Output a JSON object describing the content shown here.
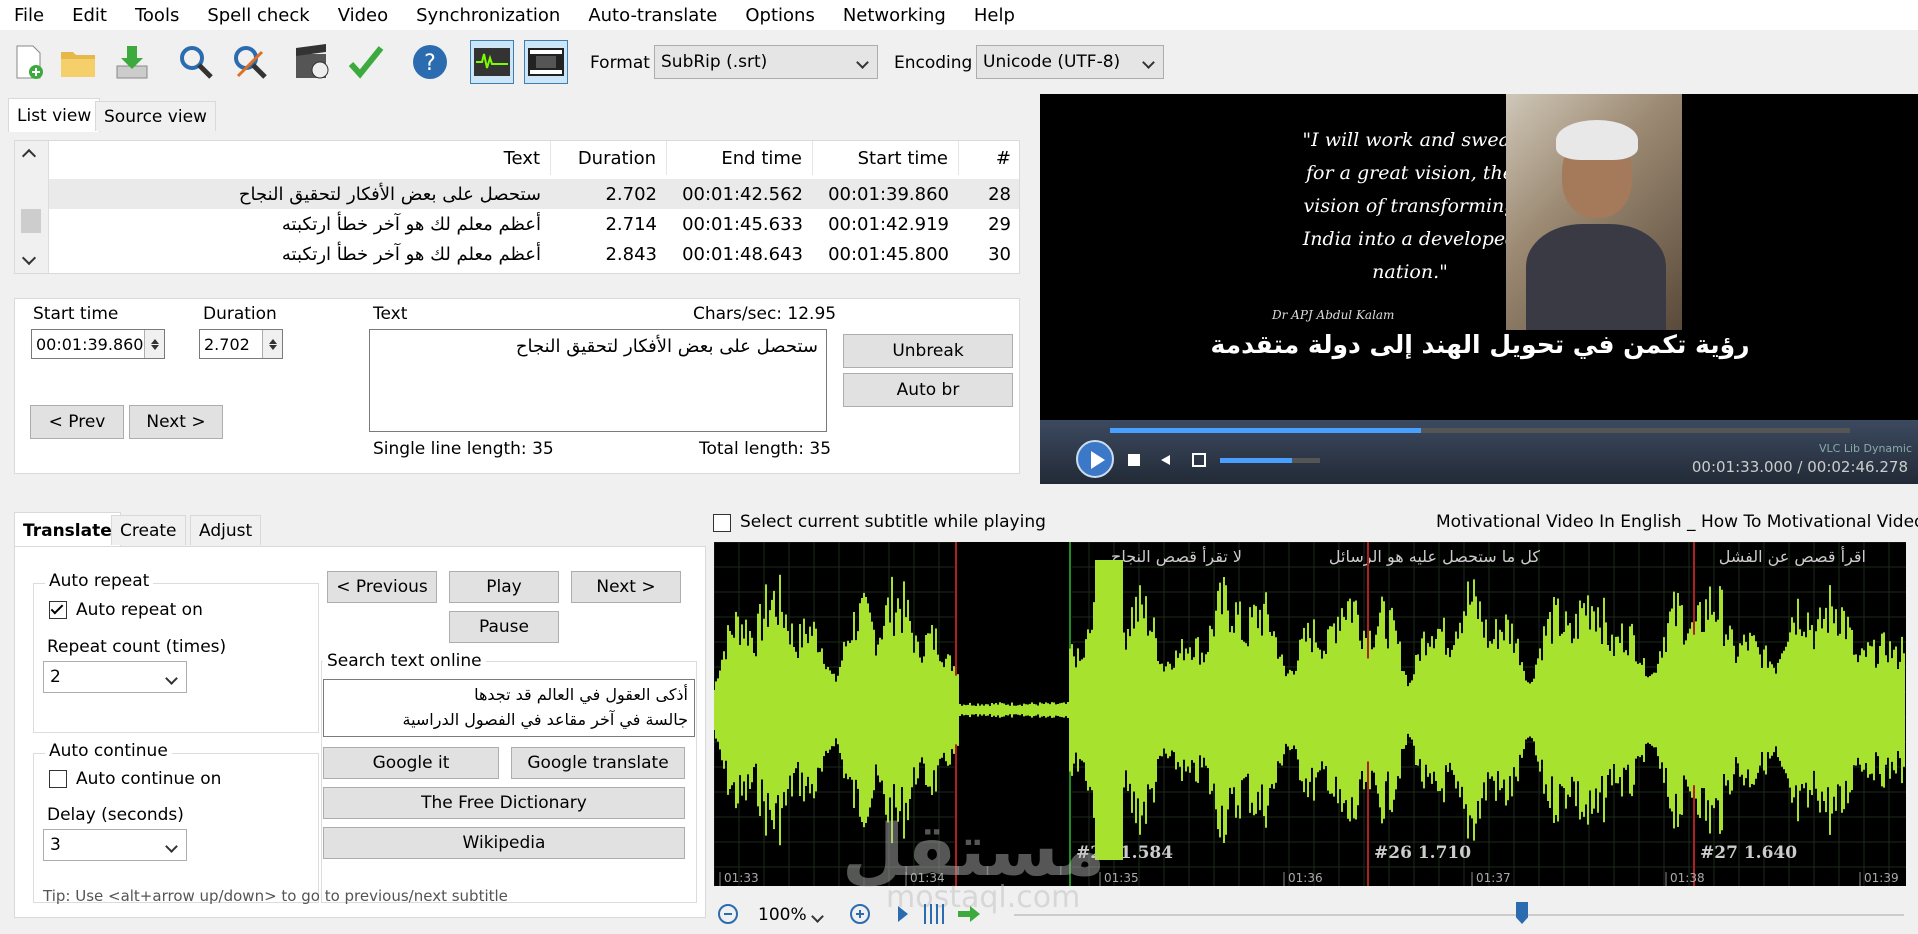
{
  "menu": [
    "File",
    "Edit",
    "Tools",
    "Spell check",
    "Video",
    "Synchronization",
    "Auto-translate",
    "Options",
    "Networking",
    "Help"
  ],
  "toolbar": {
    "format_label": "Format",
    "format_value": "SubRip (.srt)",
    "encoding_label": "Encoding",
    "encoding_value": "Unicode (UTF-8)",
    "icons": [
      "new-file-icon",
      "open-folder-icon",
      "download-icon",
      "find-icon",
      "replace-icon",
      "visual-sync-icon",
      "spell-check-icon",
      "help-icon",
      "waveform-toggle-icon",
      "video-toggle-icon"
    ]
  },
  "top_tabs": {
    "list_view": "List view",
    "source_view": "Source view"
  },
  "grid": {
    "headers": {
      "text": "Text",
      "duration": "Duration",
      "end": "End time",
      "start": "Start time",
      "num": "#"
    },
    "rows": [
      {
        "text": "ستحصل على بعض الأفكار لتحقيق النجاح",
        "duration": "2.702",
        "end": "00:01:42.562",
        "start": "00:01:39.860",
        "num": "28"
      },
      {
        "text": "أعظم معلم لك هو آخر خطأ ارتكبته",
        "duration": "2.714",
        "end": "00:01:45.633",
        "start": "00:01:42.919",
        "num": "29"
      },
      {
        "text": "أعظم معلم لك هو آخر خطأ ارتكبته",
        "duration": "2.843",
        "end": "00:01:48.643",
        "start": "00:01:45.800",
        "num": "30"
      }
    ]
  },
  "editor": {
    "start_label": "Start time",
    "start_value": "00:01:39.860",
    "duration_label": "Duration",
    "duration_value": "2.702",
    "text_label": "Text",
    "chars_sec": "Chars/sec: 12.95",
    "text_value": "ستحصل على بعض الأفكار لتحقيق النجاح",
    "prev": "< Prev",
    "next": "Next >",
    "unbreak": "Unbreak",
    "auto_br": "Auto br",
    "single_len": "Single line length: 35",
    "total_len": "Total length: 35"
  },
  "video": {
    "quote": [
      "\"I will work and sweat",
      "for a great vision, the",
      "vision of transforming",
      "India into a developed",
      "nation.\""
    ],
    "author": "Dr APJ Abdul Kalam",
    "subtitle": "رؤية تكمن في تحويل الهند إلى دولة متقدمة",
    "brand": "VLC Lib Dynamic",
    "time": "00:01:33.000 / 00:02:46.278",
    "progress": 0.42
  },
  "bottom_tabs": {
    "translate": "Translate",
    "create": "Create",
    "adjust": "Adjust"
  },
  "translate": {
    "auto_repeat_title": "Auto repeat",
    "auto_repeat_on": "Auto repeat on",
    "repeat_count_label": "Repeat count (times)",
    "repeat_count": "2",
    "auto_continue_title": "Auto continue",
    "auto_continue_on": "Auto continue on",
    "delay_label": "Delay (seconds)",
    "delay": "3",
    "previous": "< Previous",
    "play": "Play",
    "next": "Next >",
    "pause": "Pause",
    "search_title": "Search text online",
    "search_text": [
      "أذكى العقول في العالم قد تجدها",
      "جالسة في آخر مقاعد في الفصول الدراسية"
    ],
    "google_it": "Google it",
    "google_translate": "Google translate",
    "free_dict": "The Free Dictionary",
    "wikipedia": "Wikipedia",
    "tip": "Tip: Use <alt+arrow up/down> to go to previous/next subtitle"
  },
  "wave": {
    "select_label": "Select current subtitle while playing",
    "video_title": "Motivational Video In English _ How To Motivational Video _",
    "segments": [
      {
        "text": "لا تقرأ قصص النجاح",
        "label": "#25  1.584"
      },
      {
        "text": "كل ما ستحصل عليه هو الرسائل",
        "label": "#26  1.710"
      },
      {
        "text": "اقرأ قصص عن الفشل",
        "label": "#27  1.640"
      }
    ],
    "ticks": [
      "01:33",
      "01:34",
      "01:35",
      "01:36",
      "01:37",
      "01:38",
      "01:39"
    ],
    "zoom": "100%",
    "watermark": "مستقل",
    "watermark2": "mostaql.com",
    "color": "#a6e22e"
  }
}
